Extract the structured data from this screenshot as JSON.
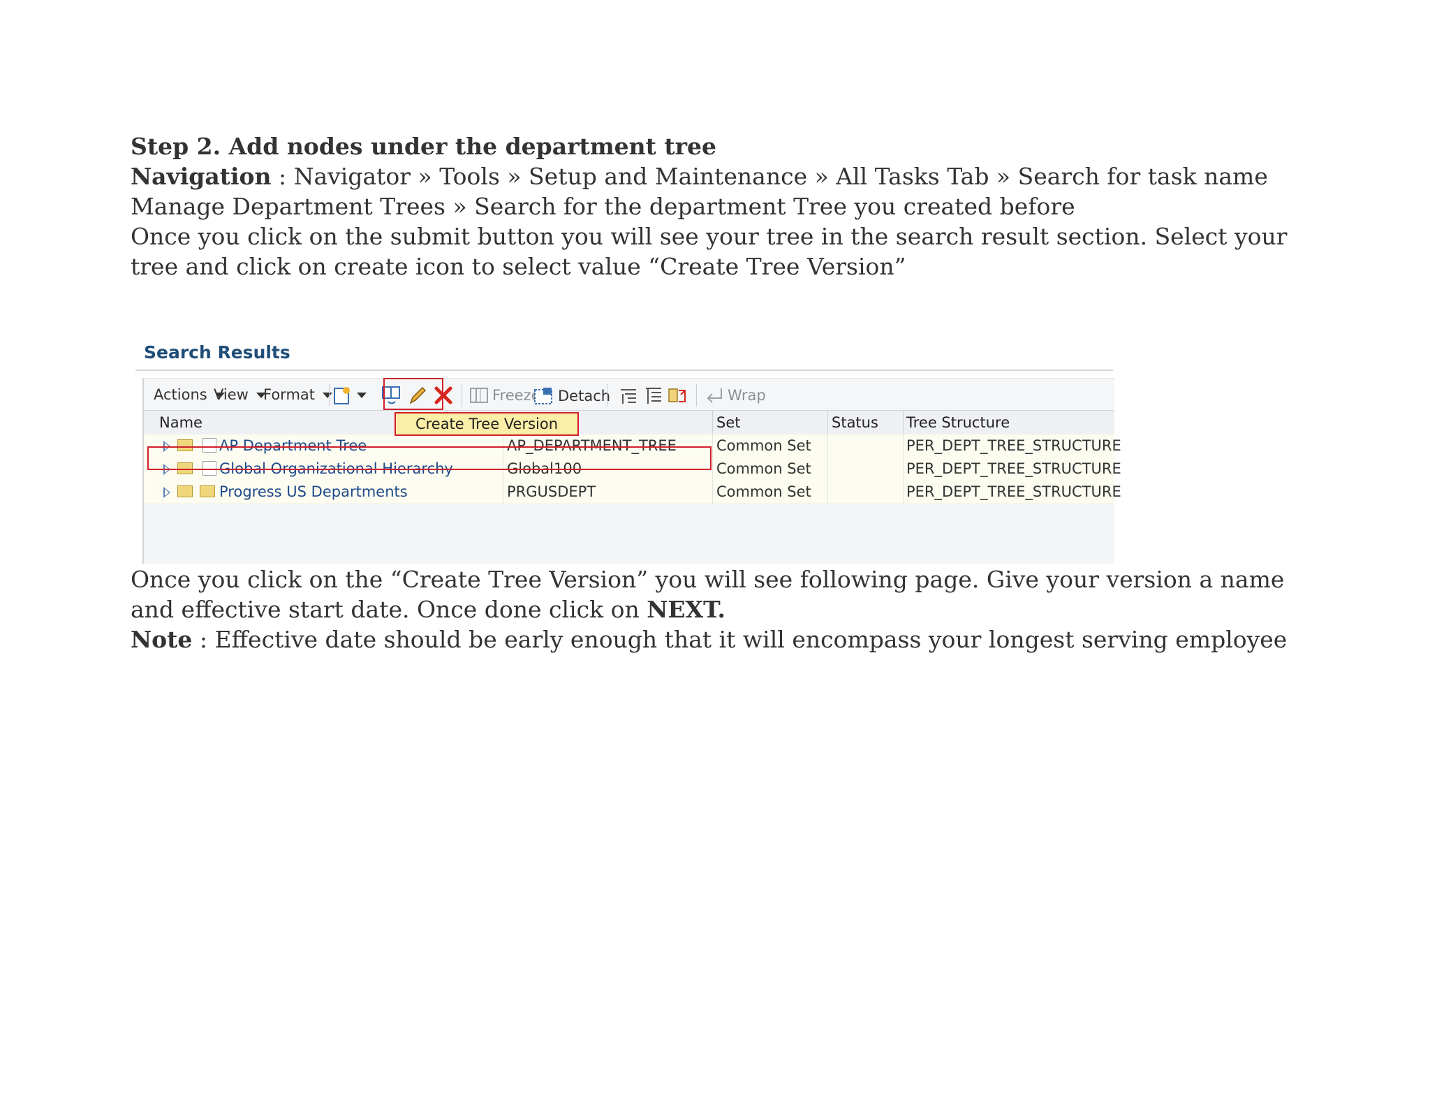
{
  "step_heading": "Step 2. Add nodes under the department tree",
  "navigation": {
    "label": "Navigation",
    "text": " : Navigator » Tools » Setup and Maintenance » All Tasks Tab » Search for task name Manage Department Trees » Search for the department Tree you created before"
  },
  "para1": "Once you click on the submit button you will see your tree in the search result section. Select your tree and click on create icon to select value “Create Tree Version”",
  "para2_text": "Once you click on the “Create Tree Version” you will see following page. Give your version a name and effective start date. Once done click on ",
  "para2_bold": "NEXT.",
  "note": {
    "label": "Note",
    "text": " : Effective date should be early enough that it will encompass your longest serving employee"
  },
  "screenshot": {
    "title": "Search Results",
    "toolbar": {
      "actions": "Actions",
      "view": "View",
      "format": "Format",
      "freeze": "Freeze",
      "detach": "Detach",
      "wrap": "Wrap"
    },
    "tooltip": "Create Tree Version",
    "columns": [
      "Name",
      "",
      "Set",
      "Status",
      "Tree Structure"
    ],
    "rows": [
      {
        "name": "AP Department Tree",
        "code": "AP_DEPARTMENT_TREE",
        "set": "Common Set",
        "status": "",
        "structure": "PER_DEPT_TREE_STRUCTURE"
      },
      {
        "name": "Global Organizational Hierarchy",
        "code": "Global100",
        "set": "Common Set",
        "status": "",
        "structure": "PER_DEPT_TREE_STRUCTURE"
      },
      {
        "name": "Progress US Departments",
        "code": "PRGUSDEPT",
        "set": "Common Set",
        "status": "",
        "structure": "PER_DEPT_TREE_STRUCTURE"
      }
    ],
    "colors": {
      "highlight": "#d0202a",
      "tooltip_bg": "#fbeea7",
      "title": "#1f4e79",
      "link": "#1f4a8a"
    }
  }
}
